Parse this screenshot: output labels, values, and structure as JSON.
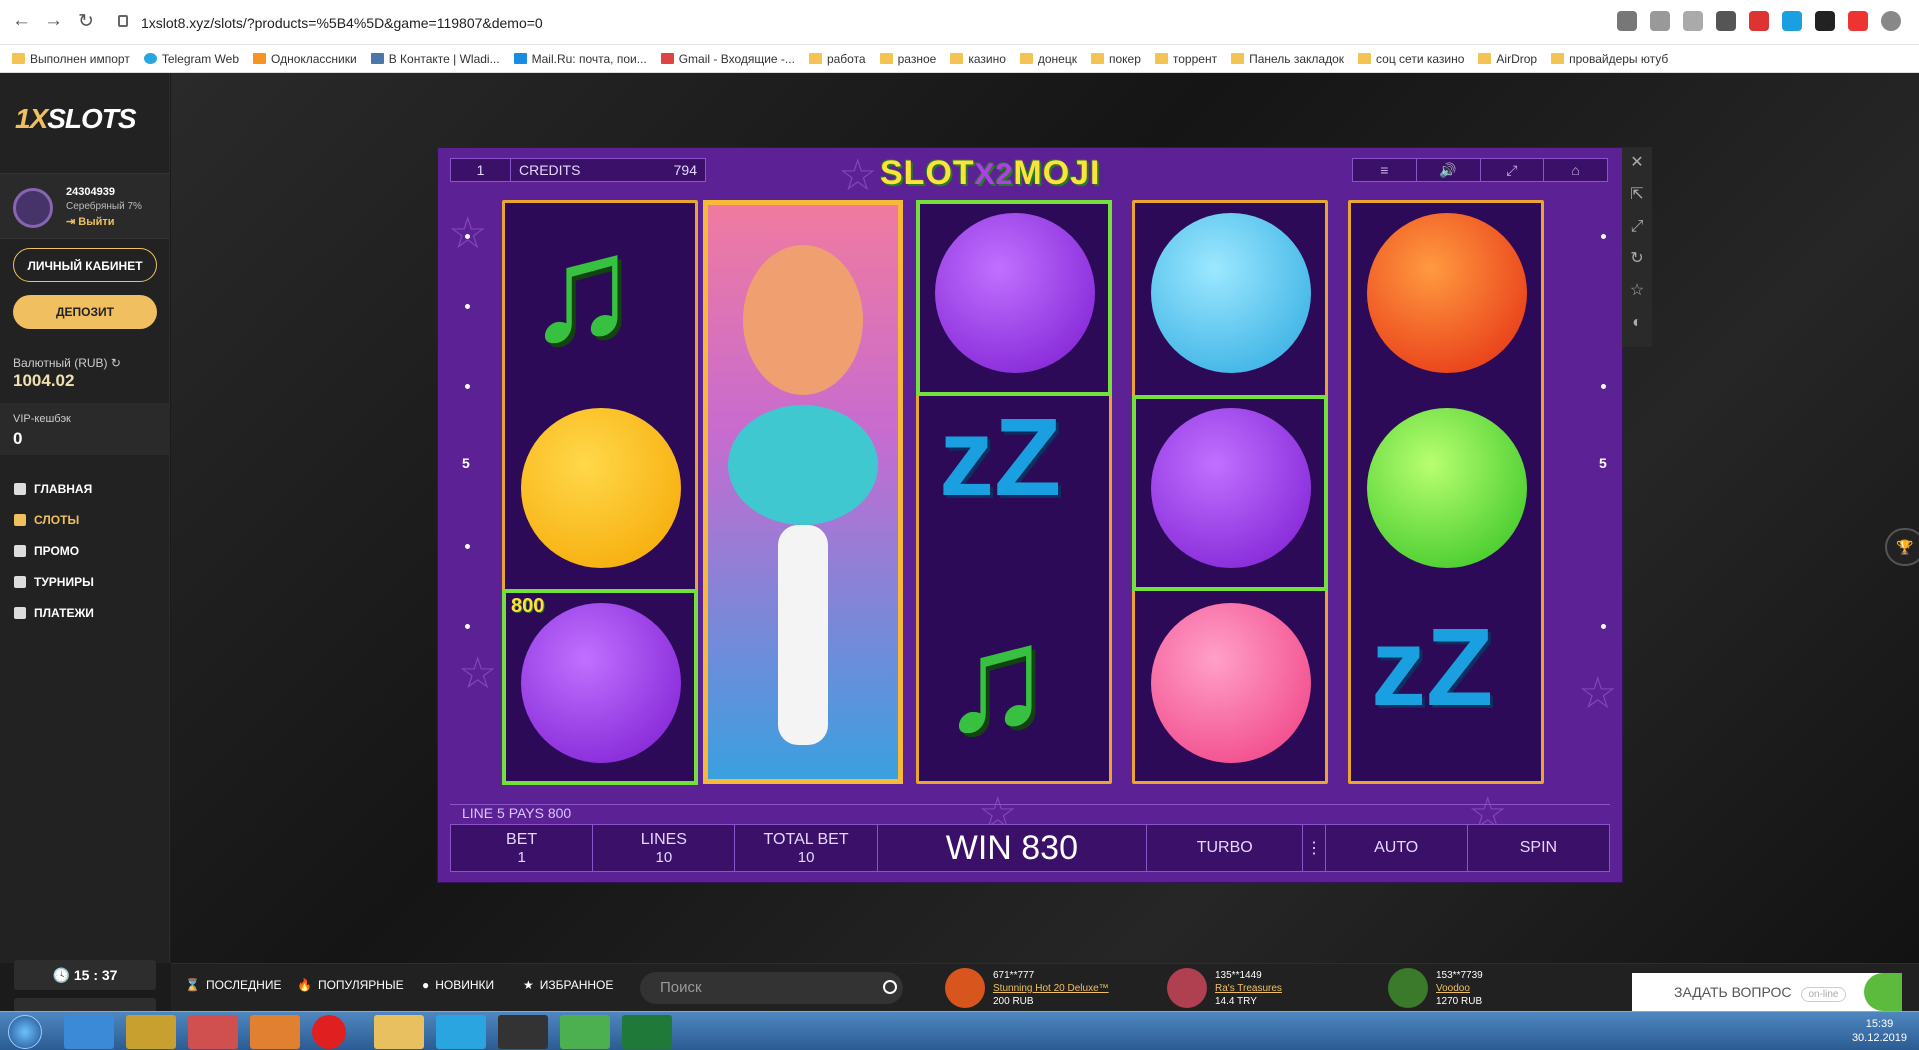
{
  "browser": {
    "url": "1xslot8.xyz/slots/?products=%5B4%5D&game=119807&demo=0",
    "bookmarks": [
      "Выполнен импорт",
      "Telegram Web",
      "Одноклассники",
      "В Контакте | Wladi...",
      "Mail.Ru: почта, пои...",
      "Gmail - Входящие -...",
      "работа",
      "разное",
      "казино",
      "донецк",
      "покер",
      "торрент",
      "Панель закладок",
      "соц сети казино",
      "AirDrop",
      "провайдеры ютуб"
    ]
  },
  "sidebar": {
    "logo_a": "1X",
    "logo_b": "SLOTS",
    "user_id": "24304939",
    "user_level": "Серебряный 7%",
    "logout": "⇥ Выйти",
    "cabinet_button": "ЛИЧНЫЙ КАБИНЕТ",
    "deposit_button": "ДЕПОЗИТ",
    "balance_label": "Валютный (RUB) ↻",
    "balance": "1004.02",
    "vip_label": "VIP-кешбэк",
    "vip_value": "0",
    "nav": [
      "ГЛАВНАЯ",
      "СЛОТЫ",
      "ПРОМО",
      "ТУРНИРЫ",
      "ПЛАТЕЖИ"
    ],
    "clock": "🕓 15 : 37"
  },
  "game": {
    "title_a": "SLOT",
    "title_x": "X2",
    "title_b": "MOJI",
    "line_no": "1",
    "credits_label": "CREDITS",
    "credits_value": "794",
    "pay_line": "LINE 5 PAYS 800",
    "frame_win": "800",
    "side_left": "5",
    "side_right": "5",
    "bet_label": "BET",
    "bet_value": "1",
    "lines_label": "LINES",
    "lines_value": "10",
    "total_label": "TOTAL BET",
    "total_value": "10",
    "win": "WIN 830",
    "turbo": "TURBO",
    "auto": "AUTO",
    "spin": "SPIN",
    "menu_icons": [
      "≡",
      "🔊",
      "⤢",
      "⌂"
    ]
  },
  "bottom": {
    "tabs": [
      "ПОСЛЕДНИЕ",
      "ПОПУЛЯРНЫЕ",
      "НОВИНКИ",
      "ИЗБРАННОЕ"
    ],
    "search_placeholder": "Поиск",
    "winners": [
      {
        "user": "671**777",
        "game": "Stunning Hot 20 Deluxe™",
        "amount": "200 RUB"
      },
      {
        "user": "135**1449",
        "game": "Ra's Treasures",
        "amount": "14.4 TRY"
      },
      {
        "user": "153**7739",
        "game": "Voodoo",
        "amount": "1270 RUB"
      }
    ],
    "ask": "ЗАДАТЬ ВОПРОС",
    "online": "on-line"
  },
  "taskbar": {
    "time": "15:39",
    "date": "30.12.2019"
  }
}
